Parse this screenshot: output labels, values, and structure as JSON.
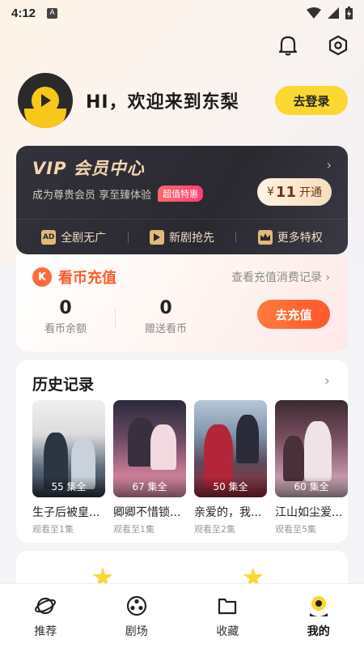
{
  "status_bar": {
    "time": "4:12",
    "notification_badge": "A"
  },
  "header": {
    "bell_icon": "bell-icon",
    "settings_icon": "settings-hexagon-icon"
  },
  "profile": {
    "greeting": "HI，欢迎来到东梨",
    "login_label": "去登录"
  },
  "vip": {
    "title": "VIP 会员中心",
    "subtitle": "成为尊贵会员 享至臻体验",
    "tag": "超值特惠",
    "currency": "¥",
    "price": "11",
    "open_label": "开通",
    "perks": [
      {
        "label": "全剧无广",
        "icon": "ad-free-icon",
        "icon_text": "AD"
      },
      {
        "label": "新剧抢先",
        "icon": "early-access-icon",
        "icon_text": ""
      },
      {
        "label": "更多特权",
        "icon": "crown-icon",
        "icon_text": ""
      }
    ]
  },
  "coins": {
    "icon_text": "K",
    "title": "看币充值",
    "record_link": "查看充值消费记录",
    "balance_value": "0",
    "balance_label": "看币余额",
    "gift_value": "0",
    "gift_label": "赠送看币",
    "recharge_label": "去充值"
  },
  "history": {
    "title": "历史记录",
    "items": [
      {
        "name": "生子后被皇...",
        "episodes": "55 集全",
        "watched": "观看至1集"
      },
      {
        "name": "卿卿不惜锁...",
        "episodes": "67 集全",
        "watched": "观看至1集"
      },
      {
        "name": "亲爱的，我...",
        "episodes": "50 集全",
        "watched": "观看至2集"
      },
      {
        "name": "江山如尘爱...",
        "episodes": "60 集全",
        "watched": "观看至5集"
      }
    ]
  },
  "tabbar": {
    "items": [
      {
        "label": "推荐",
        "icon": "planet-icon"
      },
      {
        "label": "剧场",
        "icon": "film-reel-icon"
      },
      {
        "label": "收藏",
        "icon": "folder-icon"
      },
      {
        "label": "我的",
        "icon": "profile-icon"
      }
    ],
    "active": "我的"
  },
  "colors": {
    "accent_yellow": "#fad731",
    "accent_orange": "#ff5a2a",
    "vip_dark": "#2f2e37",
    "vip_gold": "#f3d6b1"
  }
}
